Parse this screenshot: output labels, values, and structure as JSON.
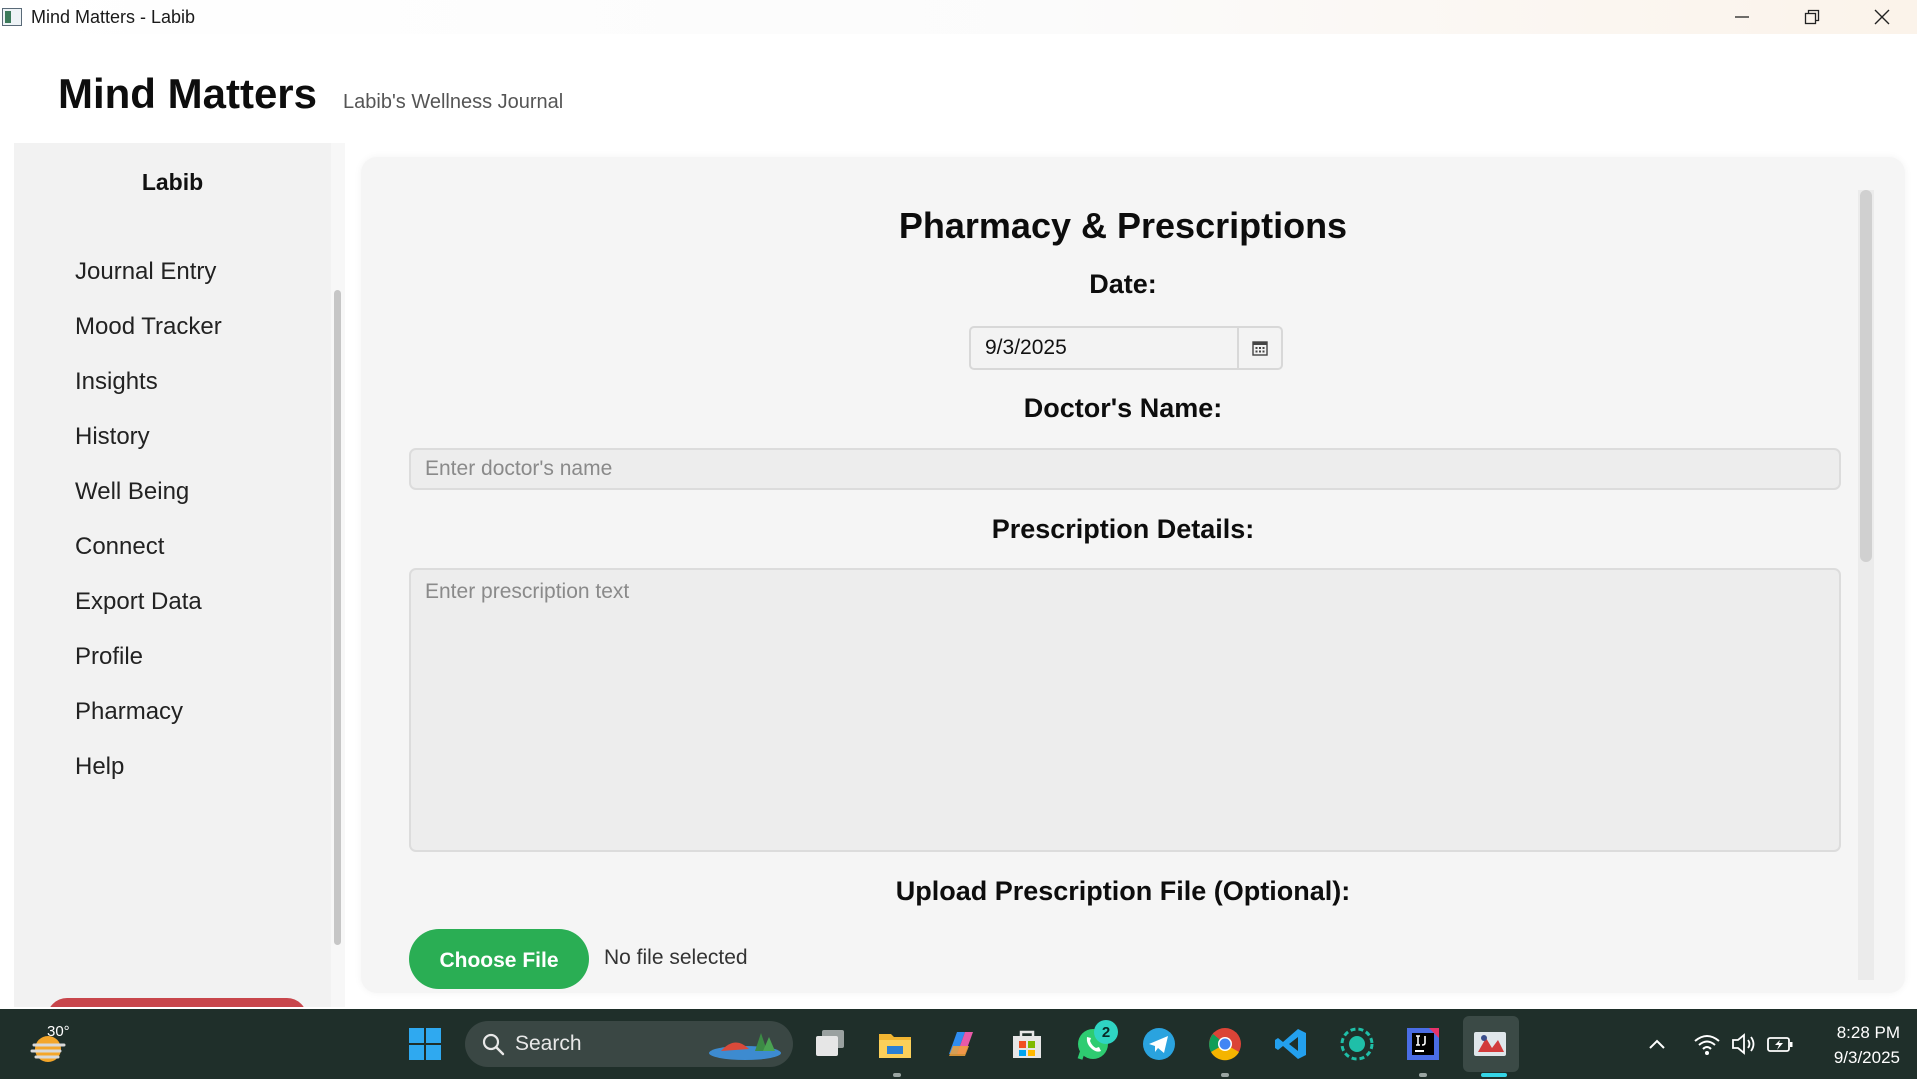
{
  "window": {
    "title": "Mind Matters - Labib",
    "minimize_glyph": "—",
    "restore_glyph": "❐",
    "close_glyph": "✕"
  },
  "header": {
    "brand": "Mind Matters",
    "tagline": "Labib's Wellness Journal"
  },
  "sidebar": {
    "user": "Labib",
    "items": [
      {
        "label": "Journal Entry"
      },
      {
        "label": "Mood Tracker"
      },
      {
        "label": "Insights"
      },
      {
        "label": "History"
      },
      {
        "label": "Well Being"
      },
      {
        "label": "Connect"
      },
      {
        "label": "Export Data"
      },
      {
        "label": "Profile"
      },
      {
        "label": "Pharmacy"
      },
      {
        "label": "Help"
      }
    ]
  },
  "form": {
    "title": "Pharmacy & Prescriptions",
    "date_label": "Date:",
    "date_value": "9/3/2025",
    "doctor_label": "Doctor's Name:",
    "doctor_placeholder": "Enter doctor's name",
    "prescription_label": "Prescription Details:",
    "prescription_placeholder": "Enter prescription text",
    "upload_label": "Upload Prescription File (Optional):",
    "choose_file_label": "Choose File",
    "file_status": "No file selected"
  },
  "taskbar": {
    "weather_temp": "30°",
    "search_label": "Search",
    "whatsapp_badge": "2",
    "clock_time": "8:28 PM",
    "clock_date": "9/3/2025"
  },
  "colors": {
    "accent_green": "#2aae54",
    "logout_red": "#c8464c",
    "taskbar_bg": "#1f2f2a"
  }
}
